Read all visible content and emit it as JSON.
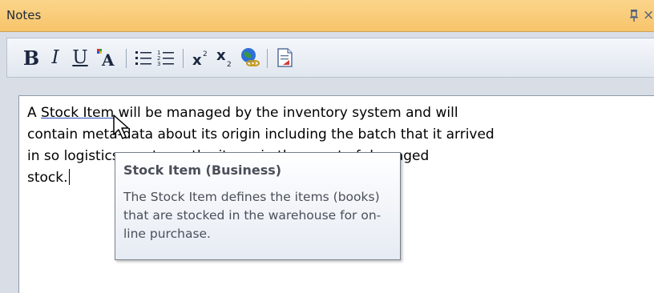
{
  "window": {
    "title": "Notes",
    "pin_icon": "pin-icon",
    "close_glyph": "×"
  },
  "toolbar": {
    "bold_label": "B",
    "italic_label": "I",
    "underline_label": "U",
    "buttons": [
      {
        "name": "bold-button",
        "icon": "bold-icon"
      },
      {
        "name": "italic-button",
        "icon": "italic-icon"
      },
      {
        "name": "underline-button",
        "icon": "underline-icon"
      },
      {
        "name": "font-color-button",
        "icon": "font-color-icon"
      },
      {
        "name": "bullet-list-button",
        "icon": "bulleted-list-icon"
      },
      {
        "name": "numbered-list-button",
        "icon": "numbered-list-icon"
      },
      {
        "name": "superscript-button",
        "icon": "superscript-icon"
      },
      {
        "name": "subscript-button",
        "icon": "subscript-icon"
      },
      {
        "name": "hyperlink-button",
        "icon": "globe-link-icon"
      },
      {
        "name": "document-link-button",
        "icon": "document-icon"
      }
    ]
  },
  "editor": {
    "line1_pre": "A ",
    "link_text": "Stock Item",
    "line1_post": " will be managed by the inventory system and will",
    "line2": "contain meta-data about its origin including the batch that it arrived",
    "line3": "in so logistics can trace the items in the event of damaged",
    "line4": "stock."
  },
  "tooltip": {
    "title": "Stock Item (Business)",
    "body": "The Stock Item defines the items (books) that are stocked in the warehouse for on-line purchase."
  },
  "colors": {
    "title_bar": "#f7c46a",
    "toolbar_bg": "#e8edf4",
    "link_underline": "#2b4dbb"
  }
}
